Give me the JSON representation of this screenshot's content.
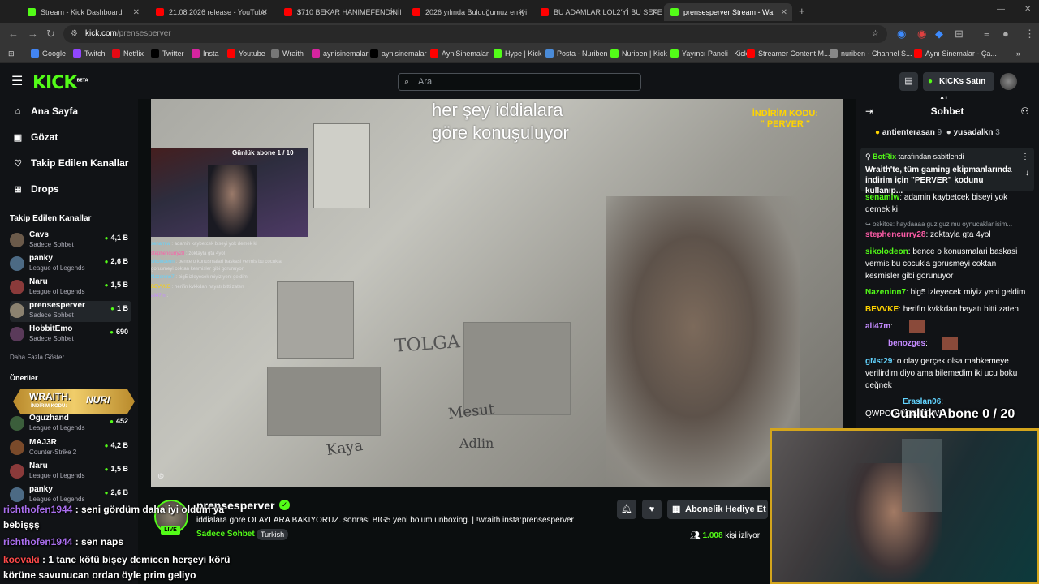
{
  "browser": {
    "tabs": [
      {
        "title": "Stream - Kick Dashboard",
        "color": "#53fc18"
      },
      {
        "title": "21.08.2026 release - YouTube",
        "color": "#ff0000"
      },
      {
        "title": "$710 BEKAR HANIMEFENDİNİN",
        "color": "#ff0000"
      },
      {
        "title": "2026 yılında Bulduğumuz en iyi",
        "color": "#ff0000"
      },
      {
        "title": "BU ADAMLAR LOL2'Yİ BU SEFER",
        "color": "#ff0000"
      },
      {
        "title": "prensesperver Stream - Wa",
        "color": "#53fc18"
      }
    ],
    "url_domain": "kick.com",
    "url_path": "/prensesperver",
    "bookmarks": [
      "Google",
      "Twitch",
      "Netflix",
      "Twitter",
      "Insta",
      "Youtube",
      "Wraith",
      "aynisinemalar",
      "aynisinemalar",
      "AyniSinemalar",
      "Hype | Kick",
      "Posta - Nuriben",
      "Nuriben | Kick",
      "Yayıncı Paneli | Kick",
      "Streamer Content M...",
      "nuriben - Channel S...",
      "Aynı Sinemalar - Ça..."
    ]
  },
  "header": {
    "logo": "KICK",
    "logo_sup": "BETA",
    "search_placeholder": "Ara",
    "buy_kicks": "KICKs Satın Al"
  },
  "sidebar": {
    "nav": [
      "Ana Sayfa",
      "Gözat",
      "Takip Edilen Kanallar",
      "Drops"
    ],
    "following_title": "Takip Edilen Kanallar",
    "following": [
      {
        "name": "Cavs",
        "category": "Sadece Sohbet",
        "viewers": "4,1 B",
        "color": "#6b5a4a"
      },
      {
        "name": "panky",
        "category": "League of Legends",
        "viewers": "2,6 B",
        "color": "#4c6a84"
      },
      {
        "name": "Naru",
        "category": "League of Legends",
        "viewers": "1,5 B",
        "color": "#8a3a3a"
      },
      {
        "name": "prensesperver",
        "category": "Sadece Sohbet",
        "viewers": "1 B",
        "color": "#8b8270"
      },
      {
        "name": "HobbitEmo",
        "category": "Sadece Sohbet",
        "viewers": "690",
        "color": "#5a3a5a"
      }
    ],
    "show_more": "Daha Fazla Göster",
    "recommended_title": "Öneriler",
    "recommended": [
      {
        "name": "Oguzhand",
        "category": "League of Legends",
        "viewers": "452",
        "color": "#3b5e3b"
      },
      {
        "name": "MAJ3R",
        "category": "Counter-Strike 2",
        "viewers": "4,2 B",
        "color": "#7a4a2a"
      },
      {
        "name": "Naru",
        "category": "League of Legends",
        "viewers": "1,5 B",
        "color": "#8a3a3a"
      },
      {
        "name": "panky",
        "category": "League of Legends",
        "viewers": "2,6 B",
        "color": "#4c6a84"
      }
    ]
  },
  "video": {
    "caption_line1": "her şey iddialara",
    "caption_line2": "göre konuşuluyor",
    "discount_line1": "İNDİRİM KODU:",
    "discount_line2": "\" PERVER \"",
    "pip_counter": "Günlük abone 1 / 10",
    "pip_chat": [
      {
        "user": "senamiw",
        "text": "adamin kaybetcek biseyi yok demek ki"
      },
      {
        "user": "stephencurry28",
        "text": "zoktayla gta 4yol"
      },
      {
        "user": "sikolodeon",
        "text": "bence o konusmalari baskasi vermis bu cocukla gorusmeyi coktan kesmisler gibi gorunuyor"
      },
      {
        "user": "Nazeninn7",
        "text": "big5 izleyecek miyiz yeni geldim"
      },
      {
        "user": "BEVVKE",
        "text": "herifin kvkkdan hayatı bitti zaten"
      },
      {
        "user": "ali47m",
        "text": ""
      }
    ],
    "wall_words": [
      "TOLGA",
      "Mesut",
      "Adlin",
      "Kaya"
    ]
  },
  "stream": {
    "name": "prensesperver",
    "title": "iddialara göre OLAYLARA BAKIYORUZ. sonrası BIG5 yeni bölüm unboxing. | !wraith insta:prensesperver",
    "category": "Sadece Sohbet",
    "language": "Turkish",
    "live": "LIVE",
    "gift_label": "Abonelik Hediye Et",
    "viewer_count": "1.008",
    "viewer_suffix": "kişi izliyor"
  },
  "chat": {
    "title": "Sohbet",
    "gifters": [
      {
        "name": "antienterasan",
        "count": "9"
      },
      {
        "name": "yusadalkn",
        "count": "3"
      }
    ],
    "pinned_by": "BotRix",
    "pinned_suffix": "tarafından sabitlendi",
    "pinned_text": "Wraith'te, tüm gaming ekipmanlarında indirim için \"PERVER\" kodunu kullanıp...",
    "messages": [
      {
        "user": "senamiw",
        "text": "adamin kaybetcek biseyi yok demek ki",
        "color": "#53fc18"
      },
      {
        "user": "oskitos",
        "text": "haydaaaa guz guz mu oynucaklar isim...",
        "color": "#9aa0a6",
        "reply": true
      },
      {
        "user": "stephencurry28",
        "text": "zoktayla gta 4yol",
        "color": "#ff5ca8"
      },
      {
        "user": "sikolodeon",
        "text": "bence o konusmalari baskasi vermis bu cocukla gorusmeyi coktan kesmisler gibi gorunuyor",
        "color": "#53fc18"
      },
      {
        "user": "Nazeninn7",
        "text": "big5 izleyecek miyiz yeni geldim",
        "color": "#53fc18"
      },
      {
        "user": "BEVVKE",
        "text": "herifin kvkkdan hayatı bitti zaten",
        "color": "#ffd400"
      },
      {
        "user": "ali47m",
        "text": "",
        "color": "#c48bff"
      },
      {
        "user": "benozges",
        "text": "",
        "color": "#c48bff"
      },
      {
        "user": "gNst29",
        "text": "o olay gerçek olsa mahkemeye verilirdim diyo ama bilemedim iki ucu boku değnek",
        "color": "#62d4ff"
      },
      {
        "user": "Eraslan06",
        "text": "QWPOQWQWQQWP",
        "color": "#62d4ff"
      }
    ]
  },
  "overlay": {
    "abone_counter": "Günlük Abone 0 / 20",
    "wraith_line1": "WRAITH.",
    "wraith_line2": "İNDİRİM KODU:",
    "wraith_code": "NURI",
    "chat_lines": [
      {
        "user": "richthofen1944",
        "text": "seni gördüm daha iyi oldum ya"
      },
      {
        "user": "",
        "text": "bebişşş"
      },
      {
        "user": "richthofen1944",
        "text": "sen naps"
      },
      {
        "user": "koovaki",
        "text": "1 tane kötü bişey demicen herşeyi körü"
      },
      {
        "user": "",
        "text": "körüne savunucan ordan öyle prim geliyo"
      }
    ]
  }
}
